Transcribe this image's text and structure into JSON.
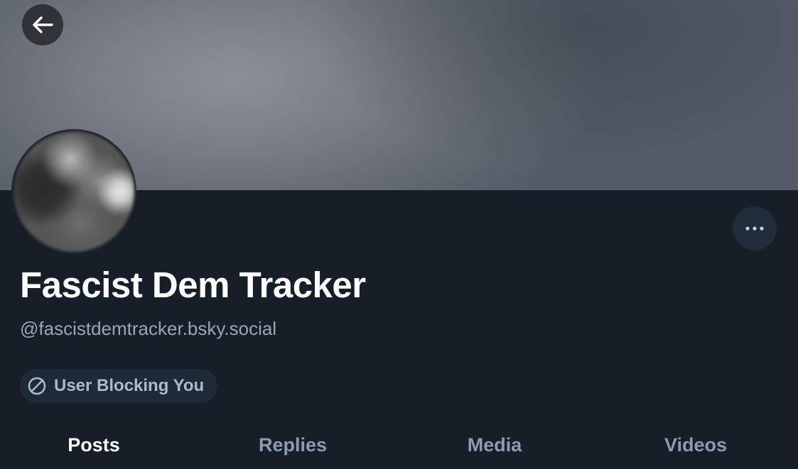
{
  "header": {
    "back_icon": "arrow-left-icon",
    "more_icon": "ellipsis-icon"
  },
  "profile": {
    "display_name": "Fascist Dem Tracker",
    "handle": "@fascistdemtracker.bsky.social",
    "block_badge": {
      "icon": "block-icon",
      "label": "User Blocking You"
    }
  },
  "tabs": [
    {
      "label": "Posts",
      "active": true
    },
    {
      "label": "Replies",
      "active": false
    },
    {
      "label": "Media",
      "active": false
    },
    {
      "label": "Videos",
      "active": false
    }
  ],
  "colors": {
    "background": "#161e27",
    "text_primary": "#ffffff",
    "text_secondary": "#9aa7b8",
    "badge_background": "#1f2a38"
  }
}
